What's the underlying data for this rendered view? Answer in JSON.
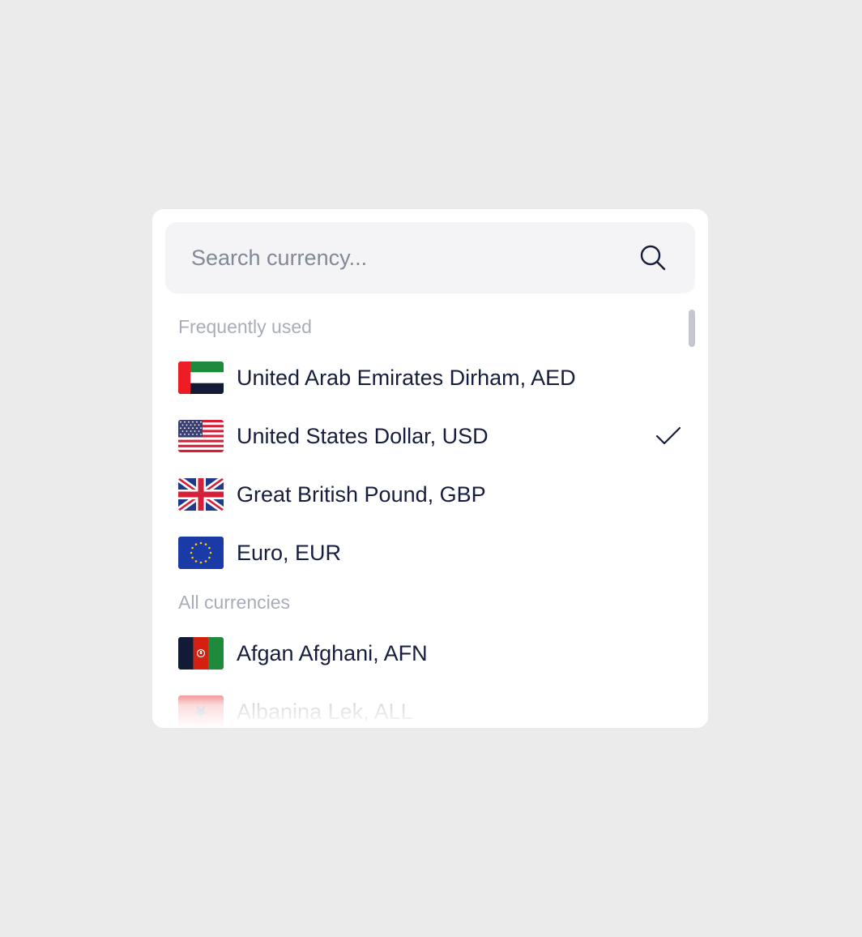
{
  "search": {
    "placeholder": "Search currency...",
    "value": "",
    "icon": "search-icon"
  },
  "sections": {
    "frequent": "Frequently used",
    "all": "All currencies"
  },
  "frequently_used": [
    {
      "label": "United Arab Emirates Dirham, AED",
      "flag": "uae-flag-icon",
      "selected": false
    },
    {
      "label": "United States Dollar, USD",
      "flag": "usa-flag-icon",
      "selected": true
    },
    {
      "label": "Great British Pound, GBP",
      "flag": "uk-flag-icon",
      "selected": false
    },
    {
      "label": "Euro, EUR",
      "flag": "eu-flag-icon",
      "selected": false
    }
  ],
  "all_currencies": [
    {
      "label": "Afgan Afghani, AFN",
      "flag": "afghanistan-flag-icon",
      "selected": false
    },
    {
      "label": "Albanina Lek, ALL",
      "flag": "albania-flag-icon",
      "selected": false
    }
  ],
  "colors": {
    "background": "#ebebeb",
    "panel": "#ffffff",
    "search_bg": "#f4f4f6",
    "text": "#161d3d",
    "section_title": "#a9adb9",
    "placeholder": "#838898"
  }
}
